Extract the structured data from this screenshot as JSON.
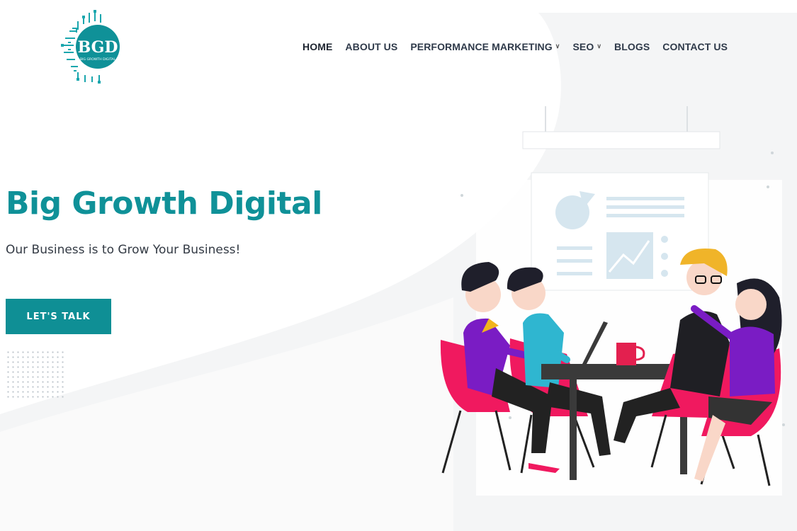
{
  "brand": {
    "logo_text": "BGD",
    "logo_subtext": "BIG GROWTH DIGITAL",
    "accent_color": "#0f9198"
  },
  "nav": {
    "items": [
      {
        "label": "HOME",
        "active": true,
        "dropdown": false
      },
      {
        "label": "ABOUT US",
        "active": false,
        "dropdown": false
      },
      {
        "label": "PERFORMANCE MARKETING",
        "active": false,
        "dropdown": true
      },
      {
        "label": "SEO",
        "active": false,
        "dropdown": true
      },
      {
        "label": "BLOGS",
        "active": false,
        "dropdown": false
      },
      {
        "label": "CONTACT US",
        "active": false,
        "dropdown": false
      }
    ],
    "dropdown_icon": "chevron-down-icon"
  },
  "hero": {
    "title": "Big Growth Digital",
    "subtitle": "Our Business is to Grow Your Business!",
    "cta_label": "LET'S TALK"
  },
  "illustration": {
    "icon": "team-meeting-illustration",
    "chair_color": "#f0195f",
    "table_color": "#3a3a3a"
  }
}
